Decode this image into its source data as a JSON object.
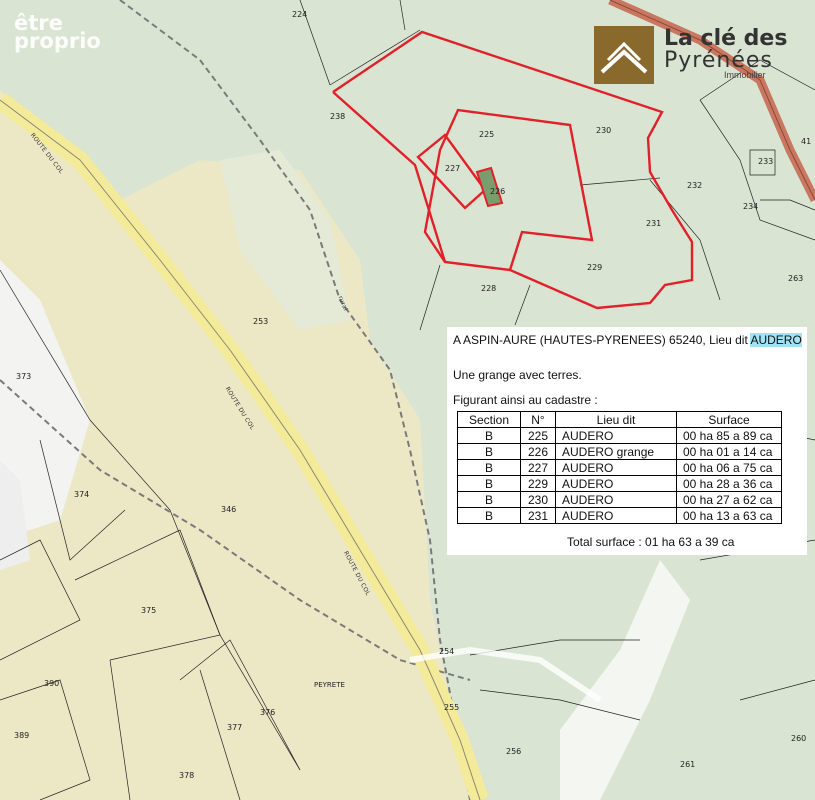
{
  "watermark": {
    "line1": "être",
    "line2": "proprio"
  },
  "logo": {
    "line1": "La clé des",
    "line2": "Pyrénées",
    "line3": "Immobilier"
  },
  "colors": {
    "parcel_outline": "#e3202a",
    "road": "#f3ea9a",
    "meadow": "#ece8c6",
    "forest": "#d9e5d2"
  },
  "parcels": [
    "224",
    "225",
    "226",
    "227",
    "228",
    "229",
    "230",
    "231",
    "232",
    "233",
    "234",
    "238",
    "253",
    "254",
    "255",
    "256",
    "260",
    "261",
    "263",
    "346",
    "373",
    "374",
    "375",
    "376",
    "377",
    "378",
    "389",
    "390",
    "41",
    "PEYRETE"
  ],
  "road_labels": {
    "route1": "ROUTE DU COL",
    "route2": "ROUTE DU COL",
    "route3": "ROUTE DU COL",
    "rural": "rural"
  },
  "info": {
    "line1_a": "A  ASPIN-AURE (HAUTES-PYRENEES)  65240, Lieu dit ",
    "line1_b": "AUDERO",
    "line2": "Une grange avec terres.",
    "line3": "Figurant ainsi au cadastre :",
    "headers": [
      "Section",
      "N°",
      "Lieu dit",
      "Surface"
    ],
    "rows": [
      [
        "B",
        "225",
        "AUDERO",
        "00 ha 85 a 89 ca"
      ],
      [
        "B",
        "226",
        "AUDERO grange",
        "00 ha 01 a 14 ca"
      ],
      [
        "B",
        "227",
        "AUDERO",
        "00 ha 06 a 75 ca"
      ],
      [
        "B",
        "229",
        "AUDERO",
        "00 ha 28 a 36 ca"
      ],
      [
        "B",
        "230",
        "AUDERO",
        "00 ha 27 a 62 ca"
      ],
      [
        "B",
        "231",
        "AUDERO",
        "00 ha 13 a 63 ca"
      ]
    ],
    "total": "Total surface : 01 ha 63 a 39 ca"
  }
}
